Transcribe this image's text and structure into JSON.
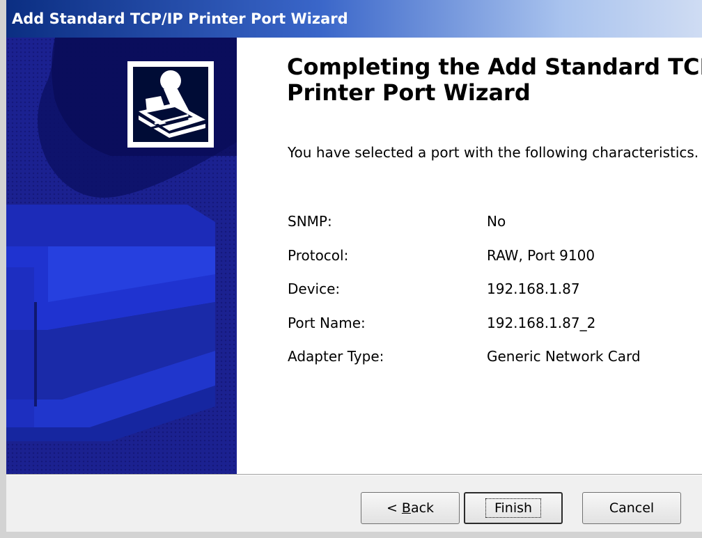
{
  "window": {
    "title": "Add Standard TCP/IP Printer Port Wizard"
  },
  "page": {
    "heading_line1": "Completing the Add Standard TCP/IP",
    "heading_line2": "Printer Port Wizard",
    "intro": "You have selected a port with the following characteristics."
  },
  "properties": [
    {
      "label": "SNMP:",
      "value": "No"
    },
    {
      "label": "Protocol:",
      "value": "RAW, Port 9100"
    },
    {
      "label": "Device:",
      "value": "192.168.1.87"
    },
    {
      "label": "Port Name:",
      "value": "192.168.1.87_2"
    },
    {
      "label": "Adapter Type:",
      "value": "Generic Network Card"
    }
  ],
  "buttons": {
    "back_prefix": "< ",
    "back_mnemonic": "B",
    "back_rest": "ack",
    "finish": "Finish",
    "cancel": "Cancel"
  },
  "colors": {
    "sidebar": "#1a1f8c",
    "titlebar_start": "#0b2e82"
  },
  "icons": {
    "wizard_graphic": "printer-port-icon"
  }
}
